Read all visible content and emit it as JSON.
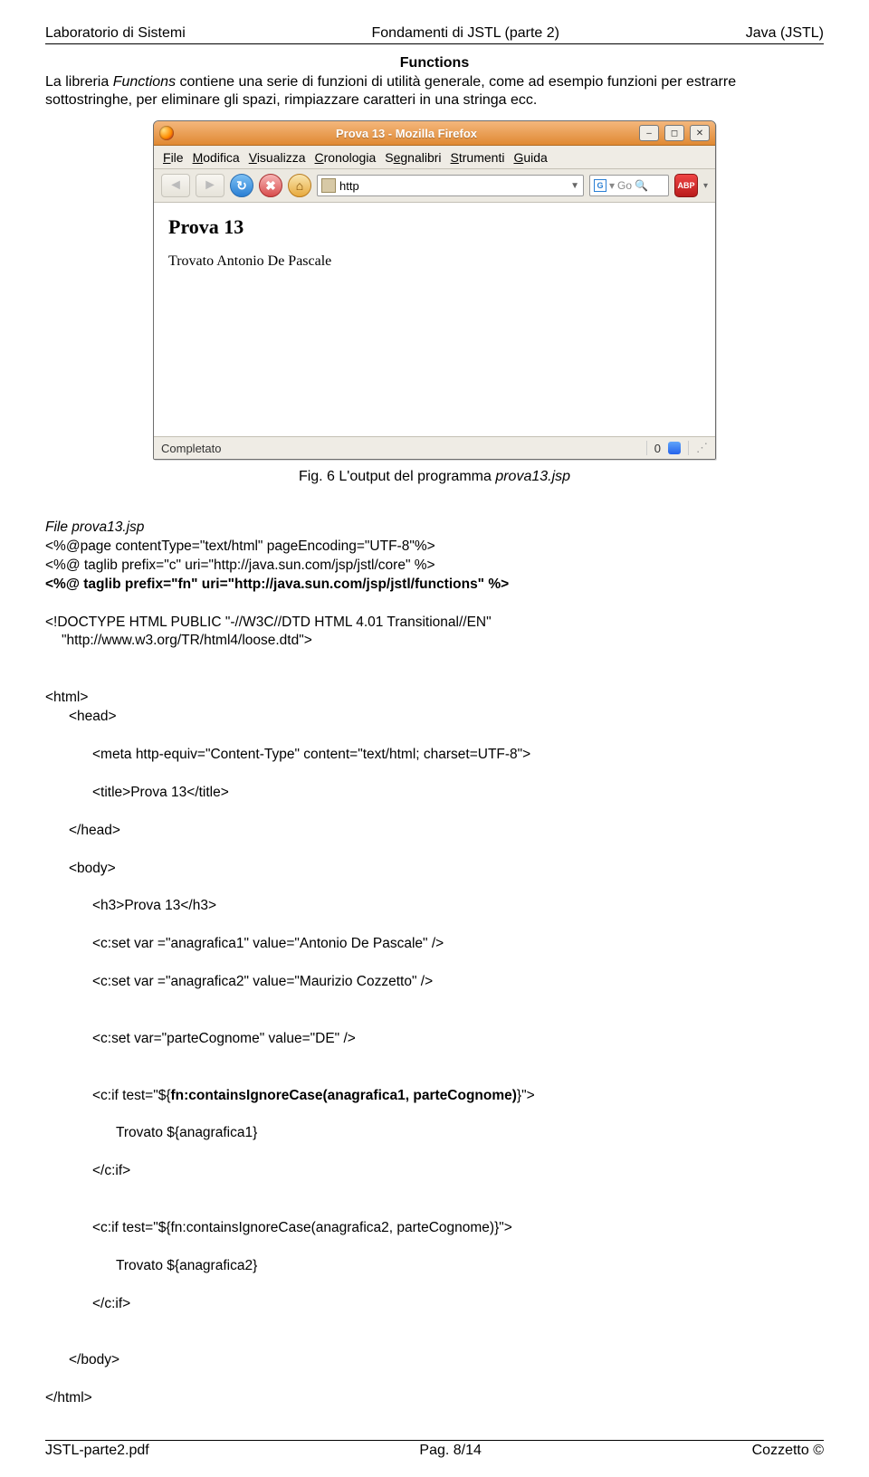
{
  "header": {
    "left": "Laboratorio di Sistemi",
    "center": "Fondamenti di JSTL (parte 2)",
    "right": "Java (JSTL)"
  },
  "footer": {
    "left": "JSTL-parte2.pdf",
    "center": "Pag. 8/14",
    "right": "Cozzetto ©"
  },
  "section_title": "Functions",
  "intro_pre": "La libreria ",
  "intro_em": "Functions",
  "intro_post": " contiene una serie di funzioni di utilità generale, come ad esempio funzioni per estrarre sottostringhe, per eliminare gli spazi, rimpiazzare caratteri in una stringa ecc.",
  "caption_pre": "Fig. 6 L'output del programma ",
  "caption_em": "prova13.jsp",
  "ff": {
    "title": "Prova 13 - Mozilla Firefox",
    "menu": {
      "file": "File",
      "modifica": "Modifica",
      "visualizza": "Visualizza",
      "cronologia": "Cronologia",
      "segnalibri": "Segnalibri",
      "strumenti": "Strumenti",
      "guida": "Guida"
    },
    "url": "http",
    "search_hint": "Go",
    "abp": "ABP",
    "page_h3": "Prova 13",
    "page_body": "Trovato Antonio De Pascale",
    "status": "Completato",
    "status_count": "0"
  },
  "code": {
    "l1_pre": "File ",
    "l1_em": "prova13.jsp",
    "l2": "<%@page contentType=\"text/html\" pageEncoding=\"UTF-8\"%>",
    "l3": "<%@ taglib prefix=\"c\" uri=\"http://java.sun.com/jsp/jstl/core\" %>",
    "l4": "<%@ taglib prefix=\"fn\" uri=\"http://java.sun.com/jsp/jstl/functions\" %>",
    "l5a": "<!DOCTYPE HTML PUBLIC \"-//W3C//DTD HTML 4.01 Transitional//EN\"",
    "l5b": "\"http://www.w3.org/TR/html4/loose.dtd\">",
    "l6": "<html>",
    "l7": "<head>",
    "l8": "<meta http-equiv=\"Content-Type\" content=\"text/html; charset=UTF-8\">",
    "l9": "<title>Prova 13</title>",
    "l10": "</head>",
    "l11": "<body>",
    "l12": "<h3>Prova 13</h3>",
    "l13": "<c:set var =\"anagrafica1\" value=\"Antonio De Pascale\" />",
    "l14": "<c:set var =\"anagrafica2\" value=\"Maurizio Cozzetto\" />",
    "l15": "<c:set var=\"parteCognome\" value=\"DE\" />",
    "l16a": "<c:if test=\"${",
    "l16b": "fn:containsIgnoreCase(anagrafica1, parteCognome)",
    "l16c": "}\">",
    "l17": "Trovato ${anagrafica1}",
    "l18": "</c:if>",
    "l19": "<c:if test=\"${fn:containsIgnoreCase(anagrafica2, parteCognome)}\">",
    "l20": "Trovato ${anagrafica2}",
    "l21": "</c:if>",
    "l22": "</body>",
    "l23": "</html>"
  }
}
